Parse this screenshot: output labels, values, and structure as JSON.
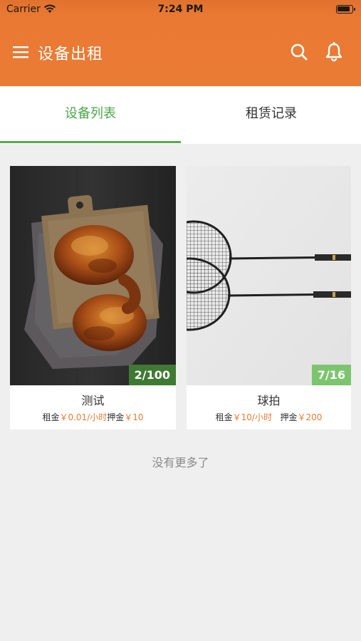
{
  "status_bar": {
    "carrier": "Carrier",
    "time": "7:24 PM"
  },
  "header": {
    "title": "设备出租",
    "icons": [
      "menu-icon",
      "search-icon",
      "bell-icon"
    ]
  },
  "tabs": [
    {
      "label": "设备列表",
      "active": true
    },
    {
      "label": "租赁记录",
      "active": false
    }
  ],
  "items": [
    {
      "name": "测试",
      "stock": "2/100",
      "rent_label": "租金",
      "rent_value": "￥0.01/小时",
      "deposit_label": "押金",
      "deposit_value": "￥10",
      "badge_color": "#3e7a33"
    },
    {
      "name": "球拍",
      "stock": "7/16",
      "rent_label": "租金",
      "rent_value": "￥10/小时",
      "deposit_label": "押金",
      "deposit_value": "￥200",
      "badge_color": "#7cc56f"
    }
  ],
  "footer_text": "没有更多了",
  "colors": {
    "accent": "#ea7b34",
    "tab_active": "#4aa84a"
  }
}
